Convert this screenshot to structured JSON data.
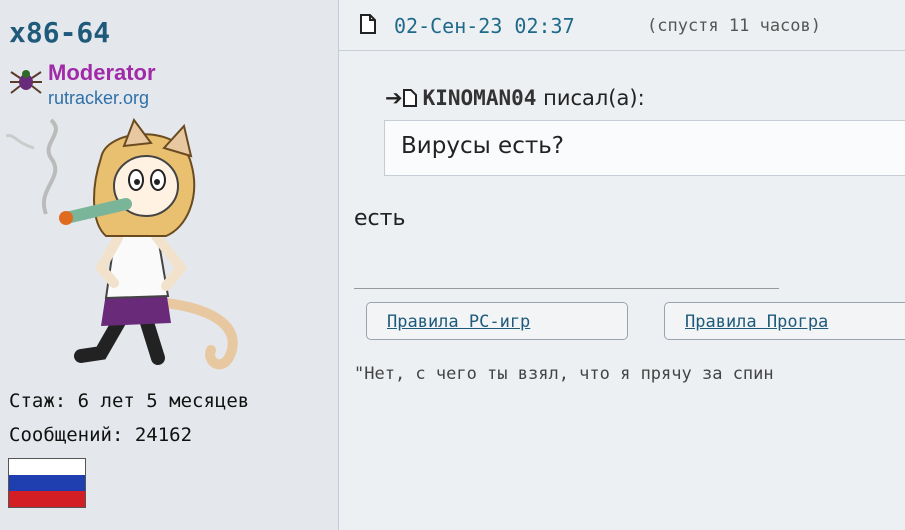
{
  "profile": {
    "username": "x86-64",
    "rank_title": "Moderator",
    "rank_site": "rutracker.org",
    "stats": {
      "tenure": "Стаж: 6 лет 5 месяцев",
      "posts": "Сообщений: 24162"
    },
    "flag": {
      "colors": [
        "#ffffff",
        "#1f3fb0",
        "#d21e24"
      ]
    }
  },
  "post": {
    "date": "02-Сен-23 02:37",
    "after": "(спустя 11 часов)",
    "quote": {
      "arrow": "➔",
      "author": "KINOMAN04",
      "wrote": "писал(а):",
      "text": "Вирусы есть?"
    },
    "message": "есть",
    "signature": {
      "buttons": [
        "Правила PC-игр",
        "Правила Програ"
      ],
      "text": "\"Нет, с чего ты взял, что я прячу за спин"
    }
  },
  "icons": {
    "post": "document-icon",
    "rank": "spider-icon"
  }
}
